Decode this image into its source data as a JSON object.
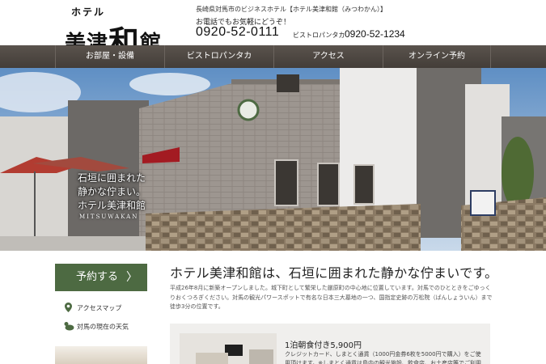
{
  "header": {
    "logo_small": "ホテル",
    "logo_main_a": "美津",
    "logo_main_b": "和",
    "logo_main_c": "館",
    "description": "長崎県対馬市のビジネスホテル【ホテル美津和館（みつわかん）】",
    "call_prompt": "お電話でもお気軽にどうぞ！",
    "tel": "0920-52-0111",
    "bistro_label": "ビストロパンタカ",
    "bistro_tel": "0920-52-1234"
  },
  "nav": {
    "items": [
      {
        "label": "お部屋・設備"
      },
      {
        "label": "ビストロパンタカ"
      },
      {
        "label": "アクセス"
      },
      {
        "label": "オンライン予約"
      }
    ]
  },
  "hero": {
    "caption_line1": "石垣に囲まれた",
    "caption_line2": "静かな佇まい。",
    "caption_line3": "ホテル美津和館",
    "caption_en": "MITSUWAKAN"
  },
  "sidebar": {
    "reserve_label": "予約する",
    "reserve_chevron": "〉",
    "access_map": "アクセスマップ",
    "weather": "対馬の現在の天気"
  },
  "main": {
    "title": "ホテル美津和館は、石垣に囲まれた静かな佇まいです。",
    "text": "平成26年8月に新築オープンしました。城下町として繁栄した厳原町の中心地に位置しています。対馬でのひとときをごゆっくりおくつろぎください。対馬の観光パワースポットで有名な日本三大墓地の一つ、国指定史跡の万松院（ばんしょういん）まで徒歩3分の位置です。",
    "plan_title": "1泊朝食付き5,900円",
    "plan_text": "クレジットカード、しまとく通貨（1000円金券6枚を5000円で購入）をご使用頂けます。※しまとく通貨は島内の観光施設、飲食店、お土産店等でご利用頂けます。"
  },
  "colors": {
    "nav_bg": "#4b4540",
    "accent_green": "#4d6a42",
    "plan_bg": "#f0efed"
  }
}
